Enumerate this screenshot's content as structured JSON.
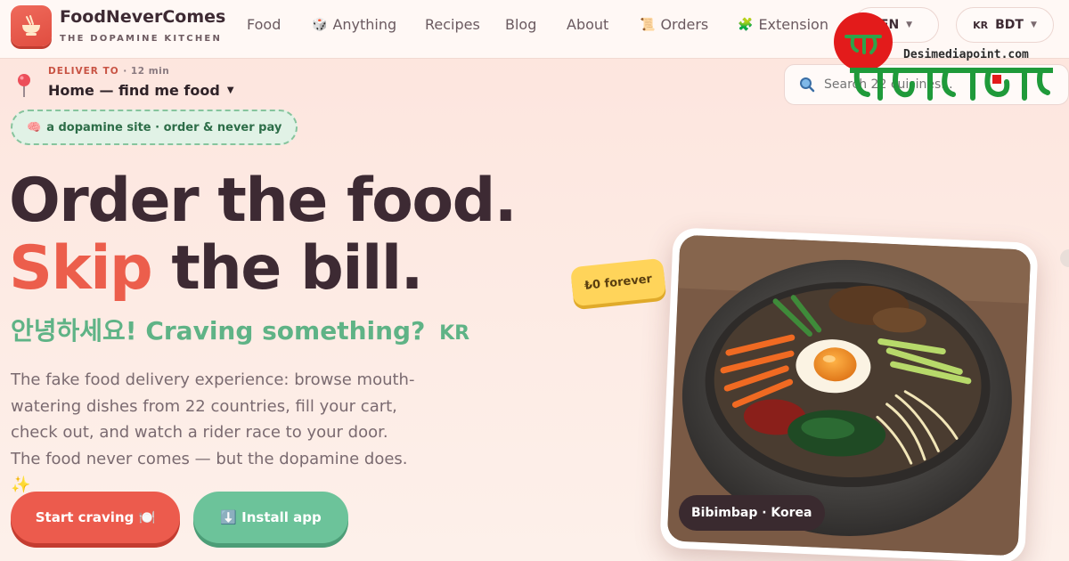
{
  "brand": {
    "name": "FoodNeverComes",
    "tagline": "THE DOPAMINE KITCHEN",
    "logo_icon": "noodle-bowl-icon"
  },
  "nav": {
    "links": [
      {
        "label": "Food",
        "icon": ""
      },
      {
        "label": "Anything",
        "icon": "dice-icon"
      },
      {
        "label": "Recipes",
        "icon": ""
      },
      {
        "label": "Blog",
        "icon": ""
      },
      {
        "label": "About",
        "icon": ""
      },
      {
        "label": "Orders",
        "icon": "scroll-icon"
      },
      {
        "label": "Extension",
        "icon": "puzzle-icon"
      }
    ],
    "language": "EN",
    "currency_country": "KR",
    "currency": "BDT"
  },
  "delivery": {
    "label": "DELIVER TO",
    "eta": "· 12 min",
    "address": "Home — find me food"
  },
  "search": {
    "placeholder": "Search 22 cuisines..."
  },
  "badge": {
    "icon": "brain-icon",
    "text": "a dopamine site · order & never pay"
  },
  "hero": {
    "line1": "Order the food.",
    "line2_accent": "Skip",
    "line2_rest": " the bill.",
    "greeting": "안녕하세요! Craving something?",
    "greeting_country": "KR",
    "description": "The fake food delivery experience: browse mouth-watering dishes from 22 countries, fill your cart, check out, and watch a rider race to your door. The food never comes — but the dopamine does. ✨"
  },
  "buttons": {
    "start": "Start craving 🍽️",
    "install": "⬇️ Install app"
  },
  "food_card": {
    "label": "Bibimbap · Korea",
    "price_tag": "₺0 forever"
  },
  "colors": {
    "accent": "#ec5e4c",
    "green": "#5fb386",
    "dark": "#3d2a33"
  },
  "watermark": {
    "script": "দেশী মিডিয়া পয়েন্ট",
    "url": "Desimediapoint.com"
  }
}
